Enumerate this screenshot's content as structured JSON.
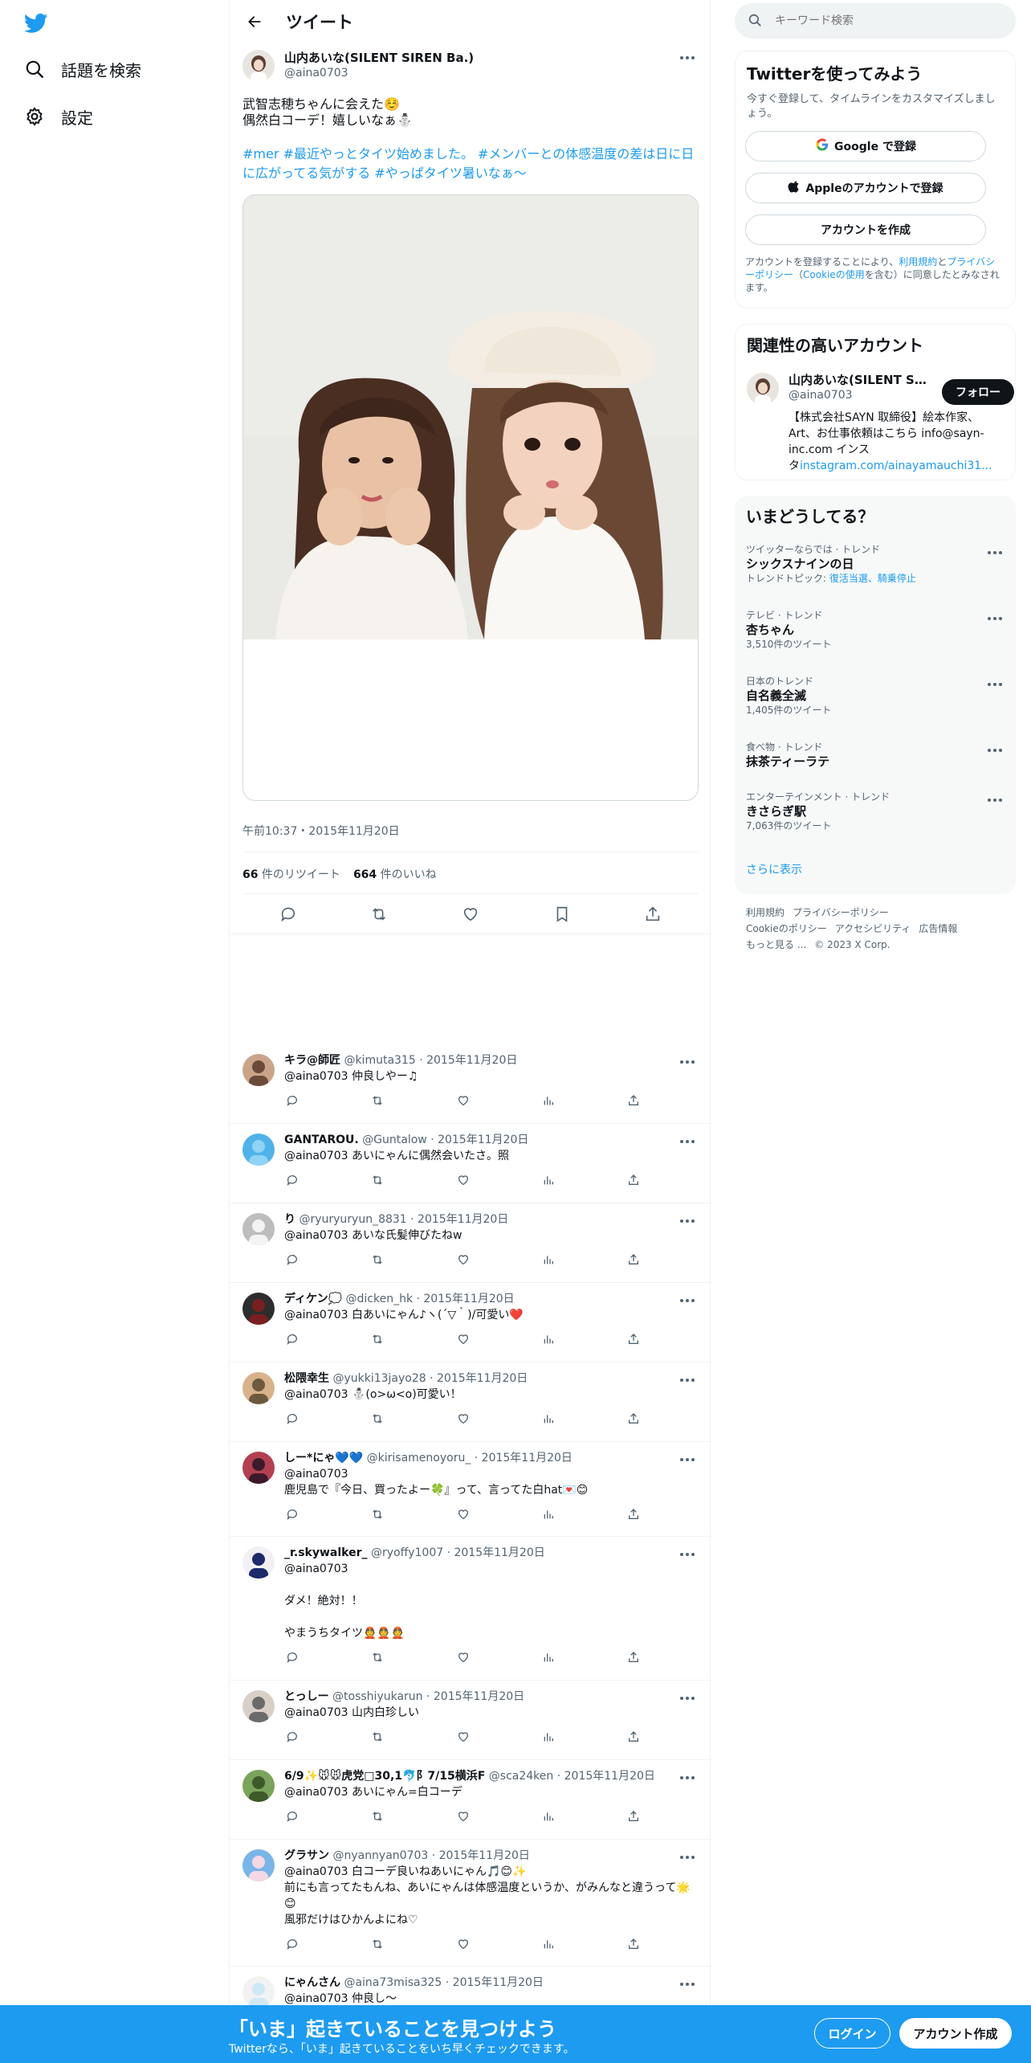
{
  "nav": {
    "explore_label": "話題を検索",
    "settings_label": "設定"
  },
  "header": {
    "title": "ツイート"
  },
  "tweet": {
    "display_name": "山内あいな(SILENT SIREN Ba.)",
    "username": "@aina0703",
    "text_line1": "武智志穂ちゃんに会えた☺️",
    "text_line2": "偶然白コーデ！嬉しいなぁ⛄",
    "hashtags": "#mer #最近やっとタイツ始めました。 #メンバーとの体感温度の差は日に日に広がってる気がする #やっぱタイツ暑いなぁ〜",
    "timestamp": "午前10:37・2015年11月20日",
    "retweets_count": "66",
    "retweets_label": " 件のリツイート",
    "likes_count": "664",
    "likes_label": " 件のいいね"
  },
  "replies": [
    {
      "name": "キラ@師匠",
      "meta": " @kimuta315 · 2015年11月20日",
      "lines": [
        "@aina0703 仲良しやー♫"
      ]
    },
    {
      "name": "GANTAROU.",
      "meta": " @Guntalow · 2015年11月20日",
      "lines": [
        "@aina0703 あいにゃんに偶然会いたさ。照"
      ]
    },
    {
      "name": "り",
      "meta": " @ryuryuryun_8831 · 2015年11月20日",
      "lines": [
        "@aina0703 あいな氏髪伸びたねw"
      ]
    },
    {
      "name": "ディケン💭",
      "meta": " @dicken_hk · 2015年11月20日",
      "lines": [
        "@aina0703 白あいにゃん♪ヽ(´▽｀)/可愛い❤️"
      ]
    },
    {
      "name": "松隈幸生",
      "meta": " @yukki13jayo28 · 2015年11月20日",
      "lines": [
        "@aina0703 ⛄(o>ω<o)可愛い！"
      ]
    },
    {
      "name": "しー*にゃ💙💙",
      "meta": " @kirisamenoyoru_ · 2015年11月20日",
      "lines": [
        "@aina0703",
        "鹿児島で『今日、買ったよー🍀』って、言ってた白hat💌😊"
      ]
    },
    {
      "name": "_r.skywalker_",
      "meta": " @ryoffy1007 · 2015年11月20日",
      "lines": [
        "@aina0703",
        "",
        "ダメ！絶対！！",
        "",
        "やまうちタイツ👲👲👲"
      ]
    },
    {
      "name": "とっしー",
      "meta": " @tosshiyukarun · 2015年11月20日",
      "lines": [
        "@aina0703 山内白珍しい"
      ]
    },
    {
      "name": "6/9✨🐭🐭虎党□30,1🐬阝7/15横浜F",
      "meta": " @sca24ken · 2015年11月20日",
      "lines": [
        "@aina0703 あいにゃん=白コーデ"
      ]
    },
    {
      "name": "グラサン",
      "meta": " @nyannyan0703 · 2015年11月20日",
      "lines": [
        "@aina0703 白コーデ良いねあいにゃん🎵😊✨",
        "前にも言ってたもんね、あいにゃんは体感温度というか、がみんなと違うって🌟😊",
        "風邪だけはひかんよにね♡"
      ]
    },
    {
      "name": "にゃんさん",
      "meta": " @aina73misa325 · 2015年11月20日",
      "lines": [
        "@aina0703 仲良し〜"
      ]
    }
  ],
  "search": {
    "placeholder": "キーワード検索"
  },
  "signup": {
    "title": "Twitterを使ってみよう",
    "subtitle": "今すぐ登録して、タイムラインをカスタマイズしましょう。",
    "google_label": "Google で登録",
    "apple_label": "Appleのアカウントで登録",
    "create_label": "アカウントを作成",
    "terms_prefix": "アカウントを登録することにより、",
    "terms_link1": "利用規約",
    "terms_and": "と",
    "terms_link2": "プライバシーポリシー",
    "terms_paren_open": "（",
    "terms_link3": "Cookieの使用",
    "terms_suffix": "を含む）に同意したとみなされます。"
  },
  "related": {
    "title": "関連性の高いアカウント",
    "display_name": "山内あいな(SILENT SIREN Ba.)",
    "username": "@aina0703",
    "follow_label": "フォロー",
    "bio_line1": "【株式会社SAYN 取締役】絵本作家、",
    "bio_line2": "Art、お仕事依頼はこちら info@sayn-",
    "bio_line3": "inc.com インス",
    "bio_line4_prefix": "タ",
    "bio_link": "instagram.com/ainayamauchi31..."
  },
  "trends": {
    "title": "いまどうしてる？",
    "items": [
      {
        "category": "ツイッターならでは · トレンド",
        "name": "シックスナインの日",
        "count_prefix": "トレンドトピック: ",
        "count_links": "復活当選、騎乗停止"
      },
      {
        "category": "テレビ · トレンド",
        "name": "杏ちゃん",
        "count": "3,510件のツイート"
      },
      {
        "category": "日本のトレンド",
        "name": "自名義全滅",
        "count": "1,405件のツイート"
      },
      {
        "category": "食べ物 · トレンド",
        "name": "抹茶ティーラテ",
        "count": ""
      },
      {
        "category": "エンターテインメント · トレンド",
        "name": "きさらぎ駅",
        "count": "7,063件のツイート"
      }
    ],
    "show_more": "さらに表示"
  },
  "footer": {
    "links": [
      "利用規約",
      "プライバシーポリシー",
      "Cookieのポリシー",
      "アクセシビリティ",
      "広告情報",
      "もっと見る ..."
    ],
    "copyright": "© 2023 X Corp."
  },
  "bottombar": {
    "title": "「いま」起きていることを見つけよう",
    "subtitle": "Twitterなら、「いま」起きていることをいち早くチェックできます。",
    "login_label": "ログイン",
    "signup_label": "アカウント作成"
  },
  "colors": {
    "accent": "#1d9bf0",
    "text": "#0f1419",
    "muted": "#536471"
  }
}
